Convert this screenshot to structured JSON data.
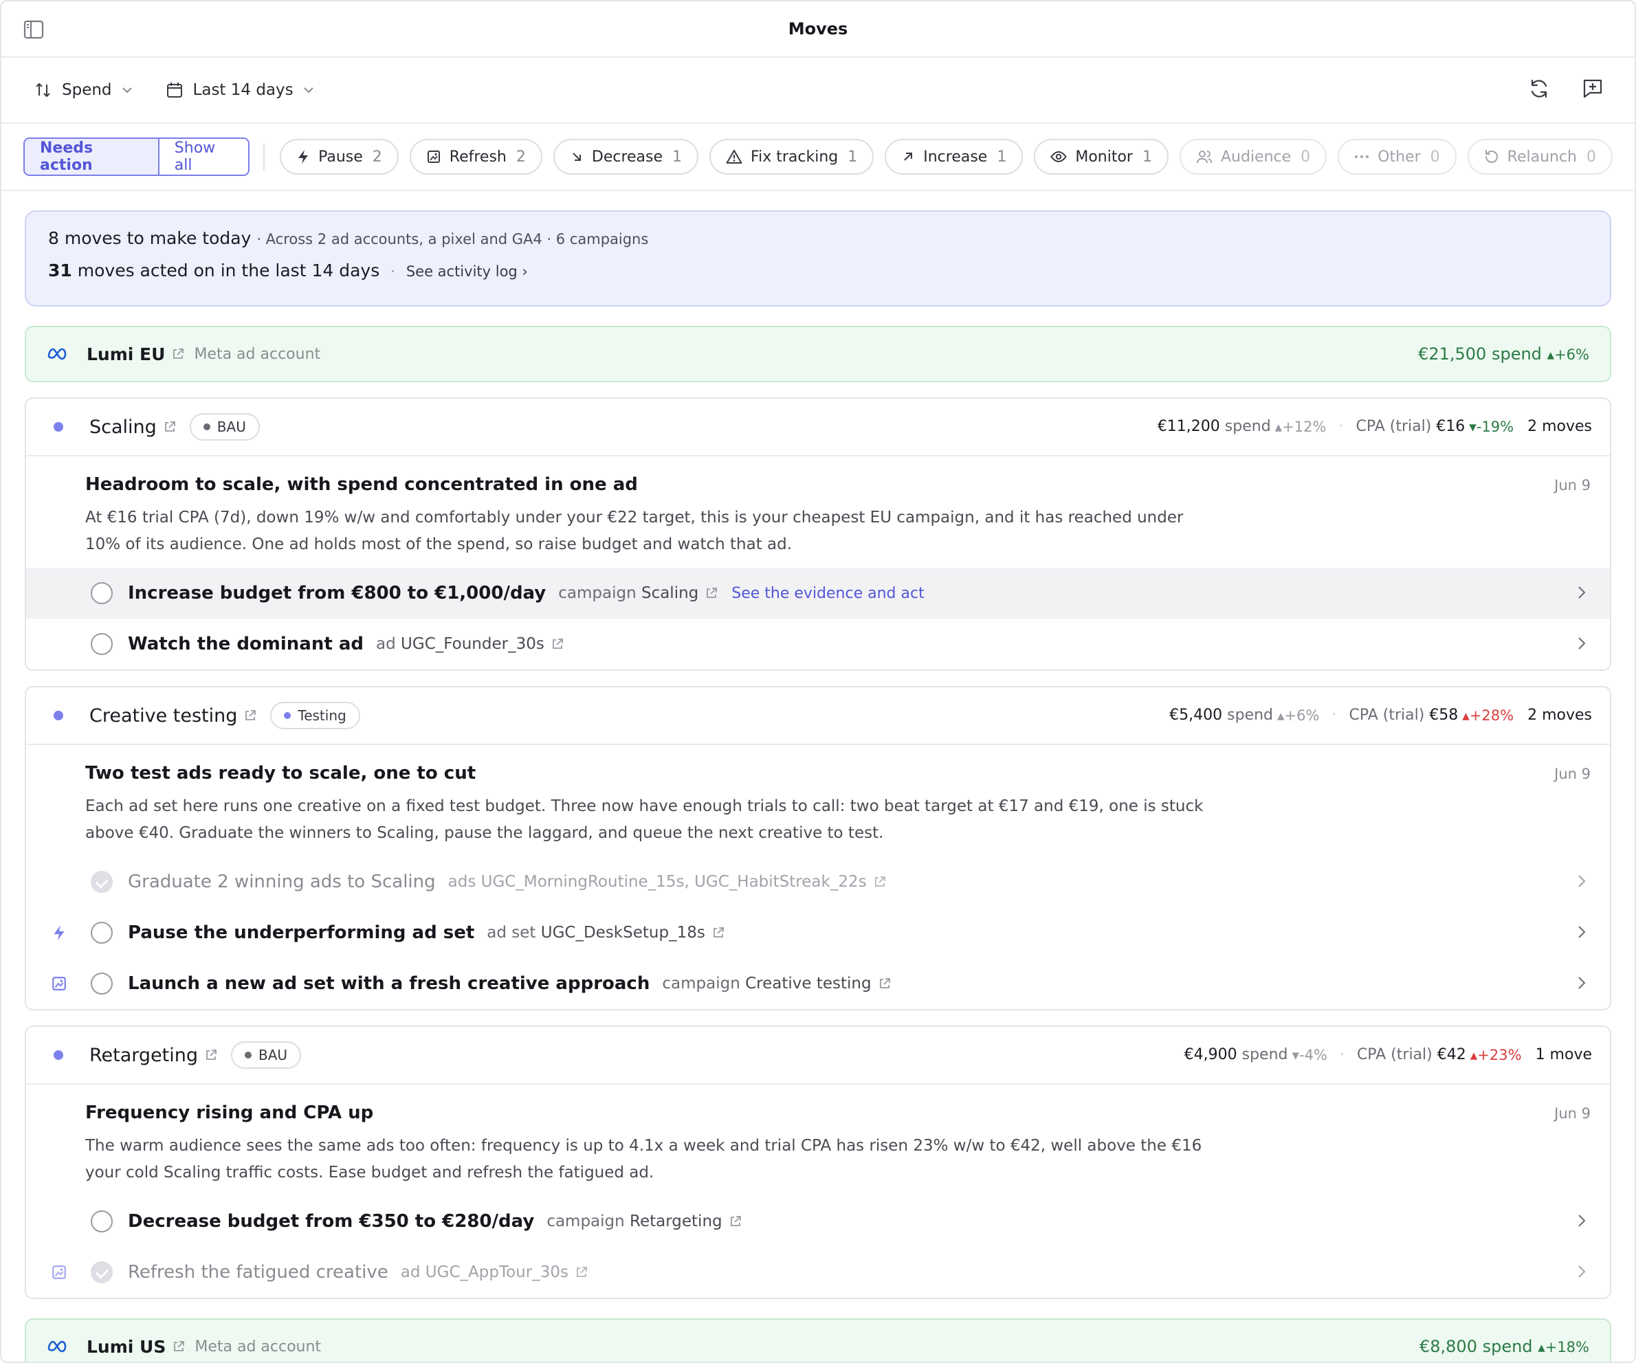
{
  "title": "Moves",
  "toolbar": {
    "sort_label": "Spend",
    "range_label": "Last 14 days"
  },
  "filters": {
    "needs_action": "Needs action",
    "show_all": "Show all",
    "chips": [
      {
        "label": "Pause",
        "count": "2"
      },
      {
        "label": "Refresh",
        "count": "2"
      },
      {
        "label": "Decrease",
        "count": "1"
      },
      {
        "label": "Fix tracking",
        "count": "1"
      },
      {
        "label": "Increase",
        "count": "1"
      },
      {
        "label": "Monitor",
        "count": "1"
      },
      {
        "label": "Audience",
        "count": "0"
      },
      {
        "label": "Other",
        "count": "0"
      },
      {
        "label": "Relaunch",
        "count": "0"
      }
    ]
  },
  "summary": {
    "today_count": "8",
    "today_text": "moves to make today",
    "today_detail": "· Across 2 ad accounts, a pixel and GA4 · 6 campaigns",
    "acted_count": "31",
    "acted_text": "moves acted on in the last 14 days",
    "acted_sep": "·",
    "activity_link": "See activity log ›"
  },
  "accounts": [
    {
      "name": "Lumi EU",
      "type": "Meta ad account",
      "spend": "€21,500 spend",
      "change": "▴+6%"
    },
    {
      "name": "Lumi US",
      "type": "Meta ad account",
      "spend": "€8,800 spend",
      "change": "▴+18%"
    }
  ],
  "campaigns": [
    {
      "name": "Scaling",
      "badge": "BAU",
      "spend": "€11,200",
      "spend_label": "spend",
      "spend_change": "▴+12%",
      "cpa_label": "CPA (trial)",
      "cpa": "€16",
      "cpa_change": "▾-19%",
      "moves": "2 moves",
      "insight_title": "Headroom to scale, with spend concentrated in one ad",
      "insight_date": "Jun 9",
      "insight_body": "At €16 trial CPA (7d), down 19% w/w and comfortably under your €22 target, this is your cheapest EU campaign, and it has reached under 10% of its audience. One ad holds most of the spend, so raise budget and watch that ad.",
      "actions": [
        {
          "title": "Increase budget from €800 to €1,000/day",
          "obj_type": "campaign",
          "obj_name": "Scaling",
          "link": "See the evidence and act"
        },
        {
          "title": "Watch the dominant ad",
          "obj_type": "ad",
          "obj_name": "UGC_Founder_30s"
        }
      ]
    },
    {
      "name": "Creative testing",
      "badge": "Testing",
      "spend": "€5,400",
      "spend_label": "spend",
      "spend_change": "▴+6%",
      "cpa_label": "CPA (trial)",
      "cpa": "€58",
      "cpa_change": "▴+28%",
      "moves": "2 moves",
      "insight_title": "Two test ads ready to scale, one to cut",
      "insight_date": "Jun 9",
      "insight_body": "Each ad set here runs one creative on a fixed test budget. Three now have enough trials to call: two beat target at €17 and €19, one is stuck above €40. Graduate the winners to Scaling, pause the laggard, and queue the next creative to test.",
      "actions": [
        {
          "title": "Graduate 2 winning ads to Scaling",
          "obj_type": "ads",
          "obj_name": "UGC_MorningRoutine_15s, UGC_HabitStreak_22s"
        },
        {
          "title": "Pause the underperforming ad set",
          "obj_type": "ad set",
          "obj_name": "UGC_DeskSetup_18s"
        },
        {
          "title": "Launch a new ad set with a fresh creative approach",
          "obj_type": "campaign",
          "obj_name": "Creative testing"
        }
      ]
    },
    {
      "name": "Retargeting",
      "badge": "BAU",
      "spend": "€4,900",
      "spend_label": "spend",
      "spend_change": "▾-4%",
      "cpa_label": "CPA (trial)",
      "cpa": "€42",
      "cpa_change": "▴+23%",
      "moves": "1 move",
      "insight_title": "Frequency rising and CPA up",
      "insight_date": "Jun 9",
      "insight_body": "The warm audience sees the same ads too often: frequency is up to 4.1x a week and trial CPA has risen 23% w/w to €42, well above the €16 your cold Scaling traffic costs. Ease budget and refresh the fatigued ad.",
      "actions": [
        {
          "title": "Decrease budget from €350 to €280/day",
          "obj_type": "campaign",
          "obj_name": "Retargeting"
        },
        {
          "title": "Refresh the fatigued creative",
          "obj_type": "ad",
          "obj_name": "UGC_AppTour_30s"
        }
      ]
    }
  ]
}
